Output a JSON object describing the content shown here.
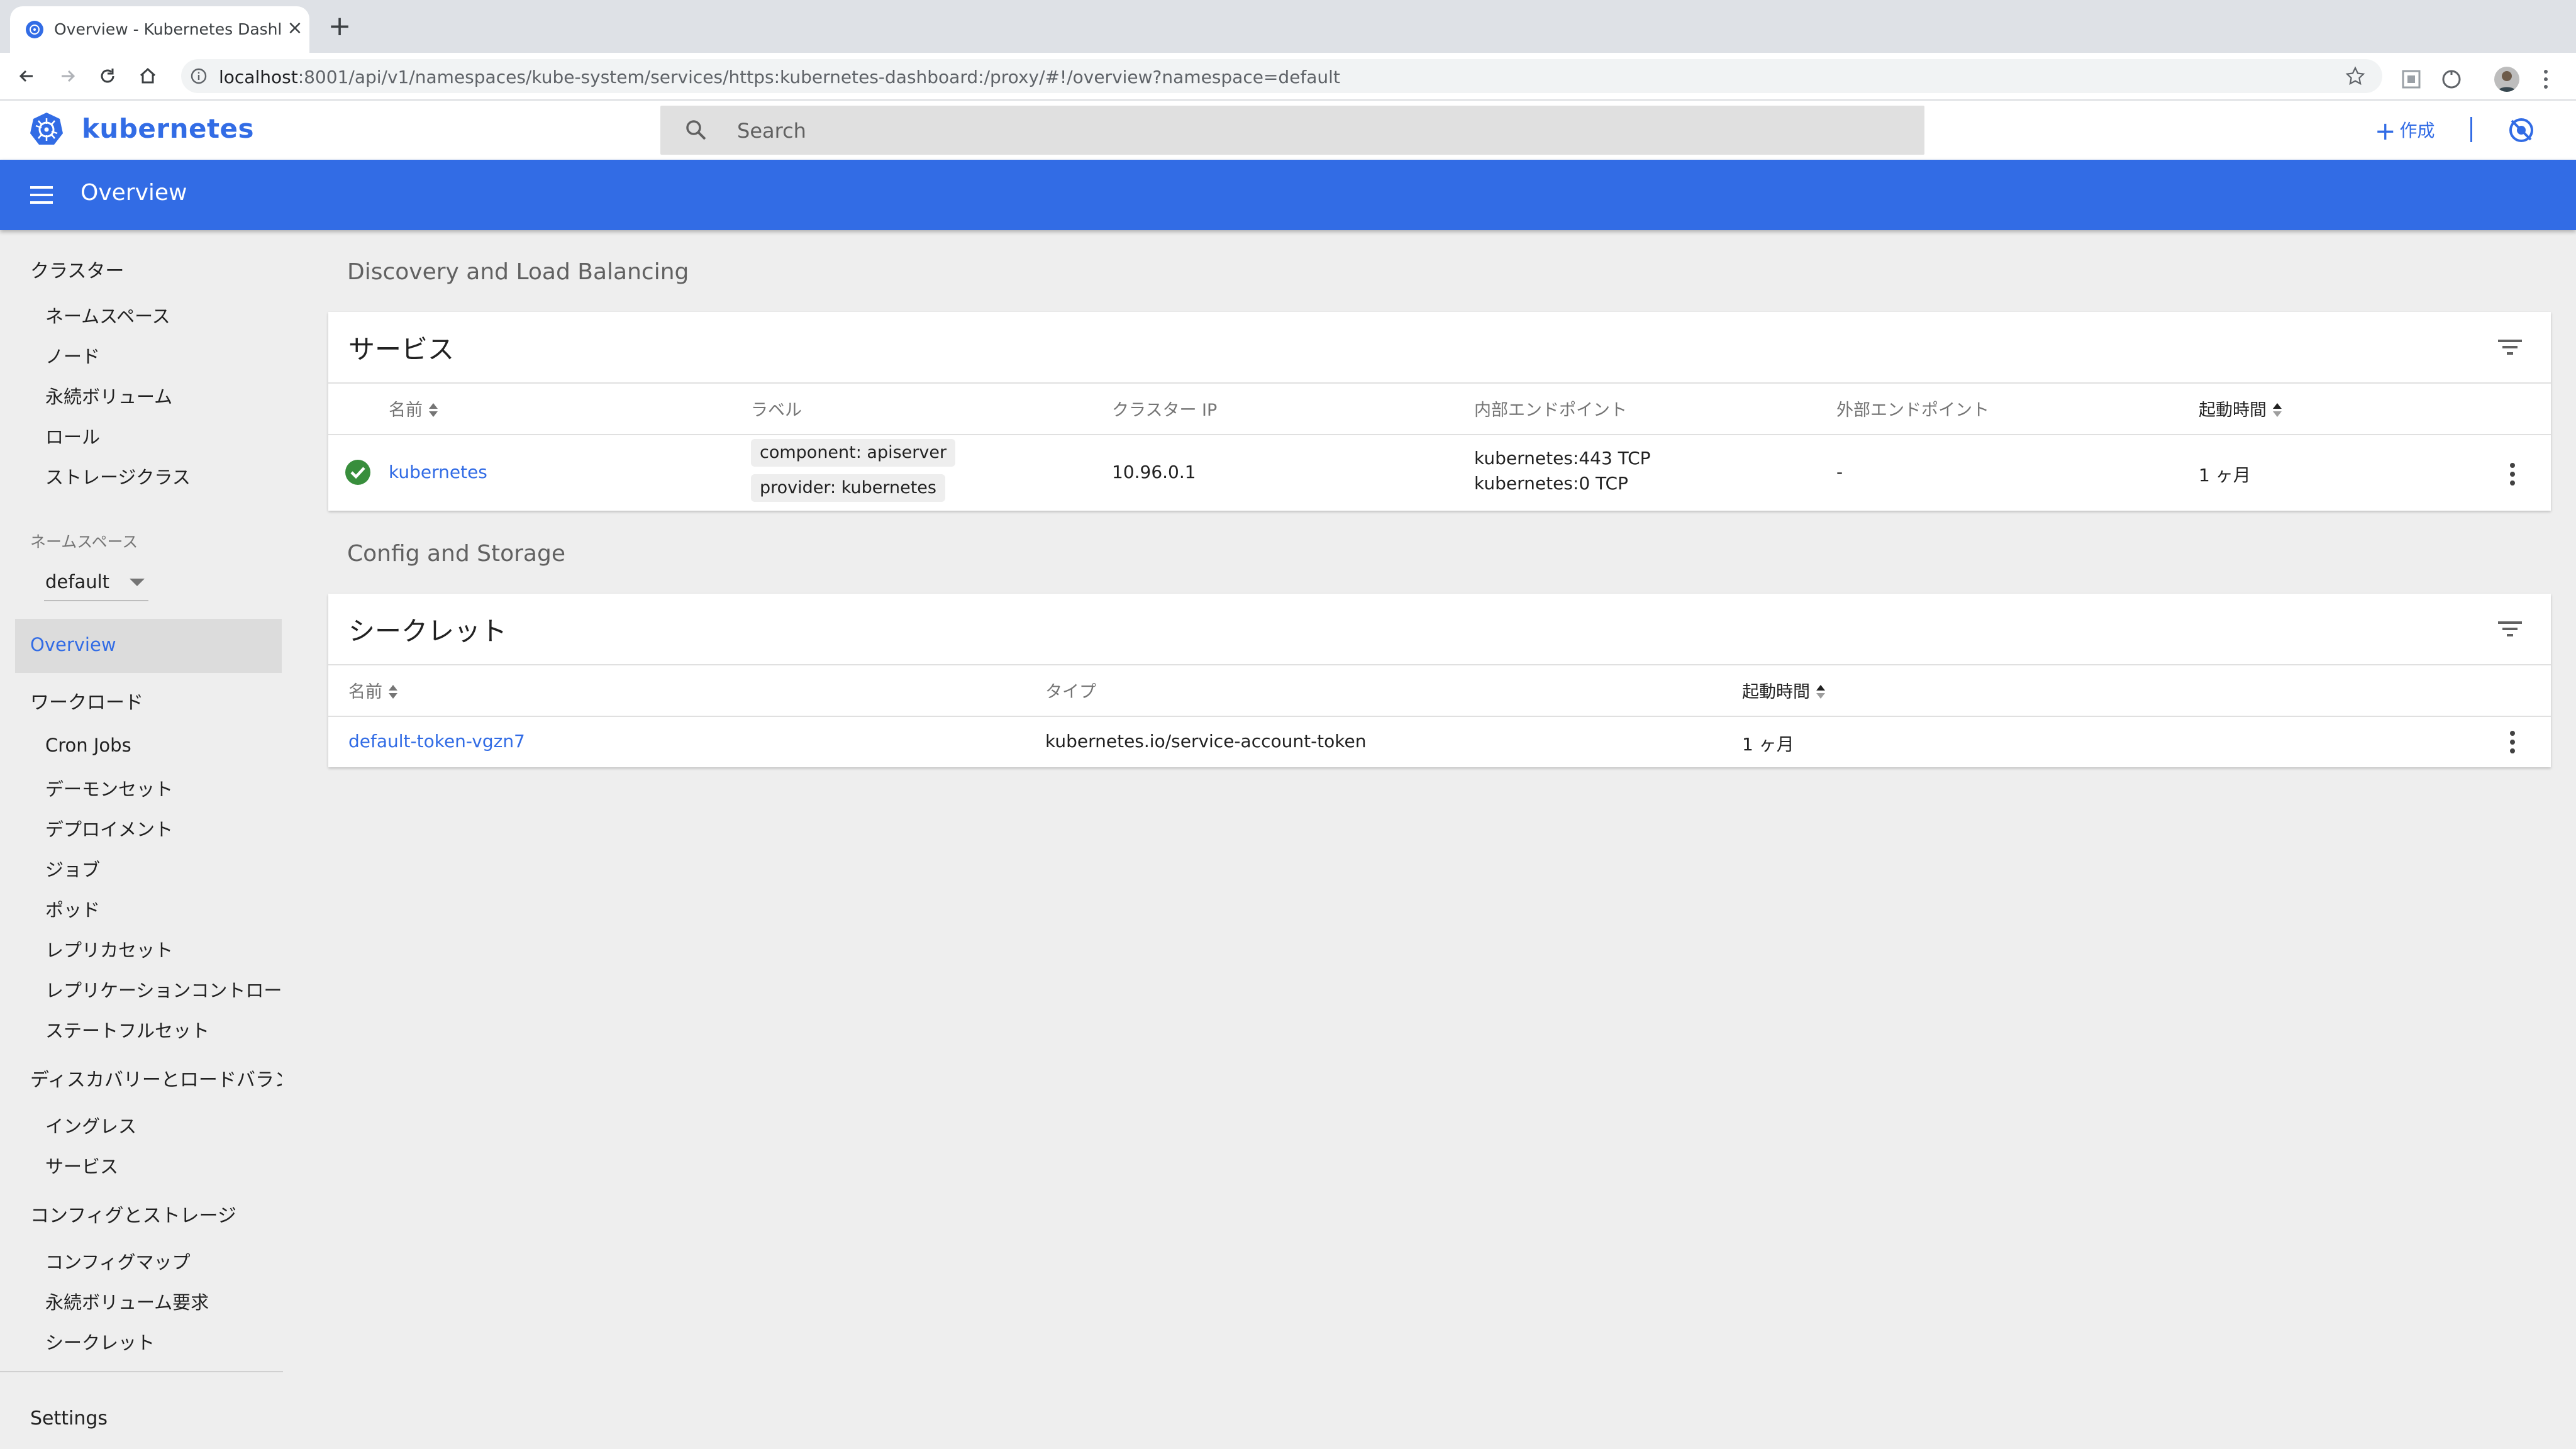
{
  "browser": {
    "tab_title": "Overview - Kubernetes Dashbo",
    "url_host": "localhost",
    "url_rest": ":8001/api/v1/namespaces/kube-system/services/https:kubernetes-dashboard:/proxy/#!/overview?namespace=default"
  },
  "app": {
    "brand": "kubernetes",
    "search_placeholder": "Search",
    "create_label": "作成",
    "page_title": "Overview",
    "accent": "#326ce5"
  },
  "sidebar": {
    "cluster": {
      "title": "クラスター",
      "items": [
        "ネームスペース",
        "ノード",
        "永続ボリューム",
        "ロール",
        "ストレージクラス"
      ]
    },
    "namespace": {
      "caption": "ネームスペース",
      "value": "default"
    },
    "active": "Overview",
    "workloads": {
      "title": "ワークロード",
      "items": [
        "Cron Jobs",
        "デーモンセット",
        "デプロイメント",
        "ジョブ",
        "ポッド",
        "レプリカセット",
        "レプリケーションコントローラ",
        "ステートフルセット"
      ]
    },
    "discovery": {
      "title": "ディスカバリーとロードバランシング",
      "items": [
        "イングレス",
        "サービス"
      ]
    },
    "config": {
      "title": "コンフィグとストレージ",
      "items": [
        "コンフィグマップ",
        "永続ボリューム要求",
        "シークレット"
      ]
    },
    "settings": "Settings"
  },
  "main": {
    "discovery_section": "Discovery and Load Balancing",
    "services": {
      "title": "サービス",
      "headers": {
        "name": "名前",
        "labels": "ラベル",
        "cluster_ip": "クラスター IP",
        "internal": "内部エンドポイント",
        "external": "外部エンドポイント",
        "age": "起動時間"
      },
      "rows": [
        {
          "name": "kubernetes",
          "labels": [
            "component: apiserver",
            "provider: kubernetes"
          ],
          "cluster_ip": "10.96.0.1",
          "internal": [
            "kubernetes:443 TCP",
            "kubernetes:0 TCP"
          ],
          "external": "-",
          "age": "1 ヶ月"
        }
      ]
    },
    "config_section": "Config and Storage",
    "secrets": {
      "title": "シークレット",
      "headers": {
        "name": "名前",
        "type": "タイプ",
        "age": "起動時間"
      },
      "rows": [
        {
          "name": "default-token-vgzn7",
          "type": "kubernetes.io/service-account-token",
          "age": "1 ヶ月"
        }
      ]
    }
  }
}
